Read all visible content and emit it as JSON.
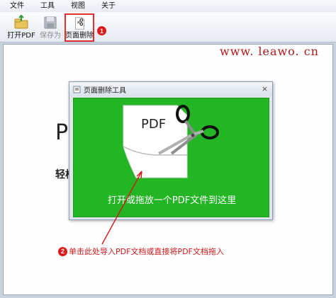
{
  "menu": {
    "items": [
      "文件",
      "工具",
      "视图",
      "关于"
    ]
  },
  "toolbar": {
    "open_pdf": "打开PDF",
    "save_as": "保存为",
    "page_delete": "页面删除"
  },
  "watermark": "www. leawo. cn",
  "background": {
    "big": "PDF",
    "small": "轻松"
  },
  "dialog": {
    "title": "页面删除工具",
    "close": "×",
    "doc_label": "PDF",
    "drop_text": "打开或拖放一个PDF文件到这里"
  },
  "annotations": {
    "step1": "1",
    "step2": "2",
    "step2_text": "单击此处导入PDF文档或直接将PDF文档拖入"
  },
  "colors": {
    "green": "#24b524",
    "annotation_red": "#d01818"
  }
}
